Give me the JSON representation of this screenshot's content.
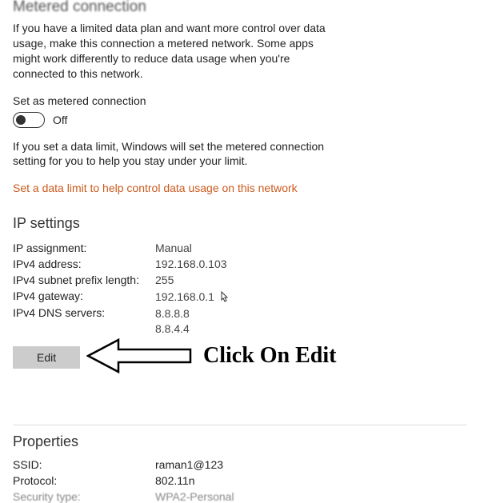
{
  "metered": {
    "title": "Metered connection",
    "description": "If you have a limited data plan and want more control over data usage, make this connection a metered network. Some apps might work differently to reduce data usage when you're connected to this network.",
    "toggle_label": "Set as metered connection",
    "toggle_state": "Off",
    "limit_desc": "If you set a data limit, Windows will set the metered connection setting for you to help you stay under your limit.",
    "limit_link": "Set a data limit to help control data usage on this network"
  },
  "ip": {
    "title": "IP settings",
    "rows": {
      "assignment_label": "IP assignment:",
      "assignment_value": "Manual",
      "addr_label": "IPv4 address:",
      "addr_value": "192.168.0.103",
      "prefix_label": "IPv4 subnet prefix length:",
      "prefix_value": "255",
      "gateway_label": "IPv4 gateway:",
      "gateway_value": "192.168.0.1",
      "dns_label": "IPv4 DNS servers:",
      "dns_value1": "8.8.8.8",
      "dns_value2": "8.8.4.4"
    },
    "edit_button": "Edit"
  },
  "annotation": {
    "text": "Click On Edit"
  },
  "properties": {
    "title": "Properties",
    "ssid_label": "SSID:",
    "ssid_value": "raman1@123",
    "protocol_label": "Protocol:",
    "protocol_value": "802.11n",
    "security_label": "Security type:",
    "security_value": "WPA2-Personal"
  }
}
